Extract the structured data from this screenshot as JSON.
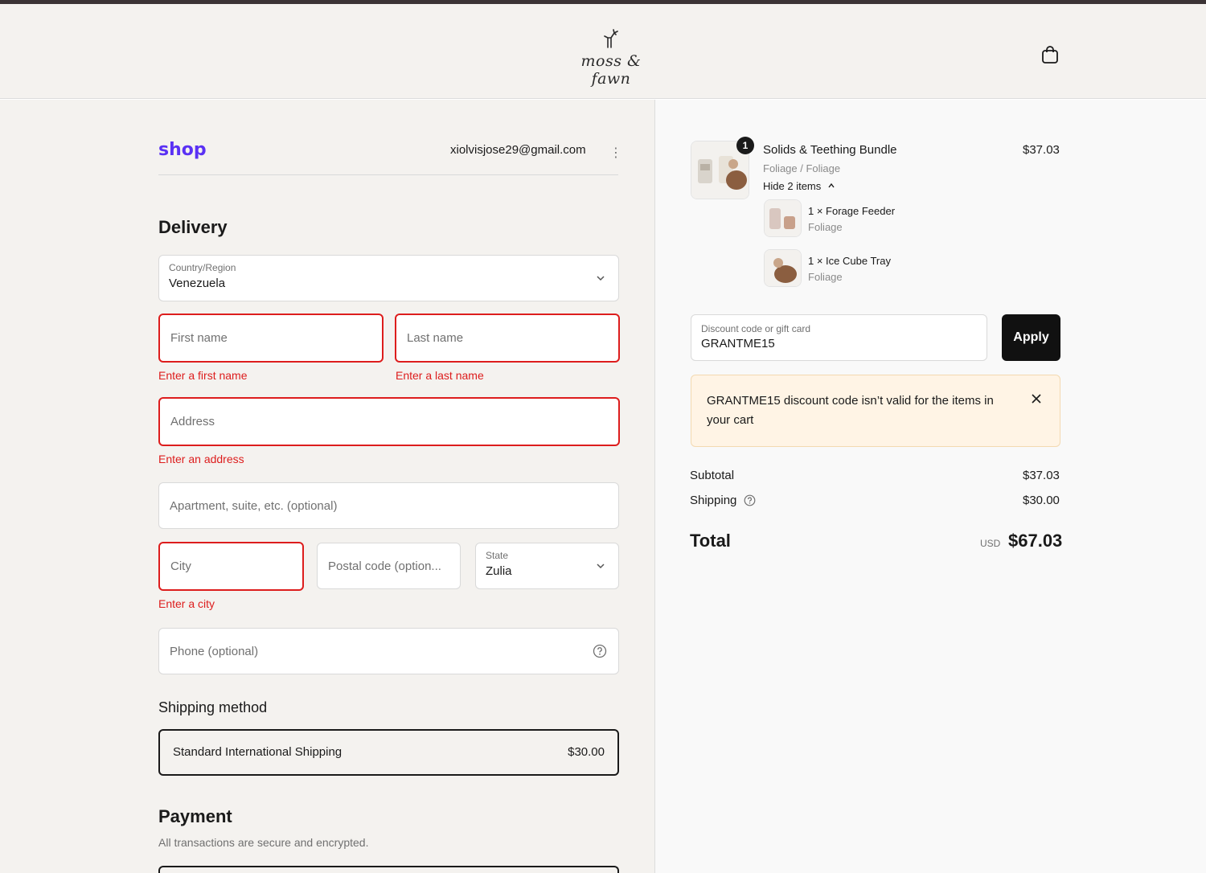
{
  "brand": {
    "name": "moss & fawn"
  },
  "account": {
    "wallet": "shop",
    "email": "xiolvisjose29@gmail.com"
  },
  "delivery": {
    "heading": "Delivery",
    "country_label": "Country/Region",
    "country_value": "Venezuela",
    "first_name_placeholder": "First name",
    "first_name_error": "Enter a first name",
    "last_name_placeholder": "Last name",
    "last_name_error": "Enter a last name",
    "address_placeholder": "Address",
    "address_error": "Enter an address",
    "apartment_placeholder": "Apartment, suite, etc. (optional)",
    "city_placeholder": "City",
    "city_error": "Enter a city",
    "postal_placeholder": "Postal code (option...",
    "state_label": "State",
    "state_value": "Zulia",
    "phone_placeholder": "Phone (optional)"
  },
  "shipping_method": {
    "heading": "Shipping method",
    "option_name": "Standard International Shipping",
    "option_price": "$30.00"
  },
  "payment": {
    "heading": "Payment",
    "note": "All transactions are secure and encrypted."
  },
  "cart": {
    "quantity_badge": "1",
    "product_title": "Solids & Teething Bundle",
    "product_variant": "Foliage / Foliage",
    "product_price": "$37.03",
    "toggle_label": "Hide 2 items",
    "items": [
      {
        "label": "1 × Forage Feeder",
        "variant": "Foliage"
      },
      {
        "label": "1 × Ice Cube Tray",
        "variant": "Foliage"
      }
    ]
  },
  "discount": {
    "label": "Discount code or gift card",
    "value": "GRANTME15",
    "apply_label": "Apply",
    "error_message": "GRANTME15 discount code isn’t valid for the items in your cart"
  },
  "summary": {
    "subtotal_label": "Subtotal",
    "subtotal_value": "$37.03",
    "shipping_label": "Shipping",
    "shipping_value": "$30.00",
    "total_label": "Total",
    "currency": "USD",
    "total_value": "$67.03"
  },
  "colors": {
    "error": "#dd1d1d",
    "shop_purple": "#5a31f4",
    "notice_bg": "#fff4e5"
  }
}
